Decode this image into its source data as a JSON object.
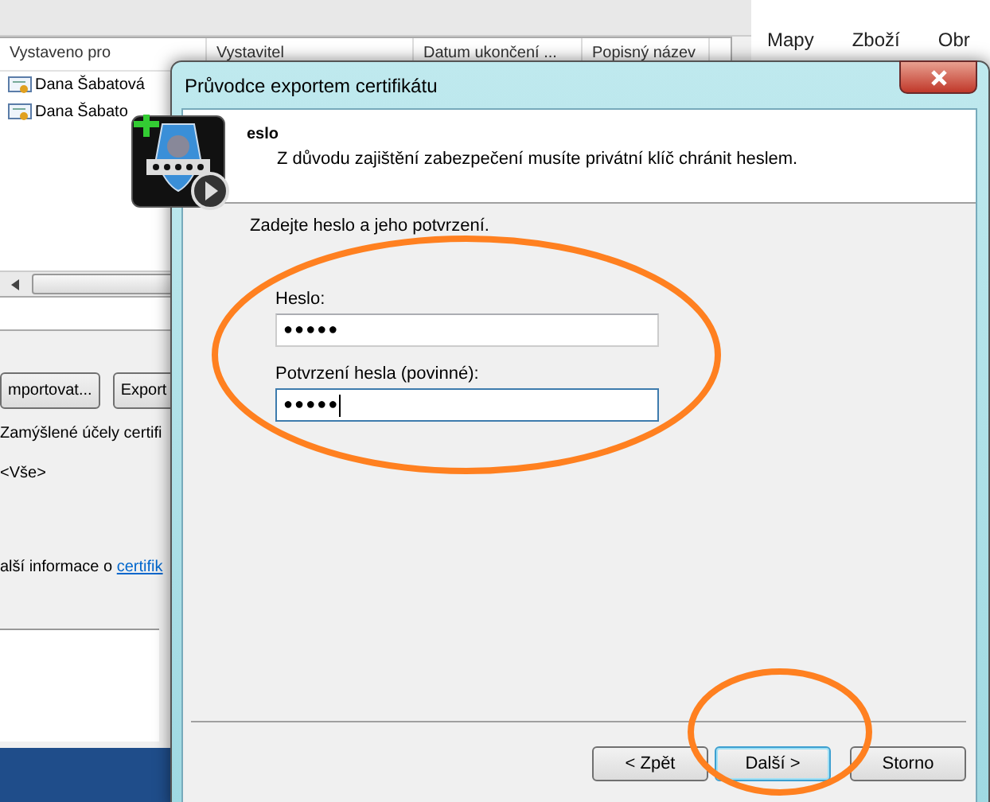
{
  "background_window": {
    "columns": [
      "Vystaveno pro",
      "Vystavitel",
      "Datum ukončení ...",
      "Popisný název"
    ],
    "rows": [
      "Dana Šabatová",
      "Dana Šabato"
    ],
    "buttons": [
      "mportovat...",
      "Export"
    ],
    "purposes_label": "Zamýšlené účely certifi",
    "purposes_value": "<Vše>",
    "info_text": "alší informace o ",
    "info_link": "certifik"
  },
  "browser": {
    "menu": [
      "Mapy",
      "Zboží",
      "Obr"
    ]
  },
  "dialog": {
    "title": "Průvodce exportem certifikátu",
    "header_title": "eslo",
    "header_subtitle": "Z důvodu zajištění zabezpečení musíte privátní klíč chránit heslem.",
    "instruction": "Zadejte heslo a jeho potvrzení.",
    "fields": [
      {
        "label": "Heslo:",
        "value": "●●●●●",
        "focused": false
      },
      {
        "label": "Potvrzení hesla (povinné):",
        "value": "●●●●●",
        "focused": true
      }
    ],
    "buttons": [
      {
        "label": "< Zpět",
        "default": false
      },
      {
        "label": "Další >",
        "default": true
      },
      {
        "label": "Storno",
        "default": false
      }
    ]
  }
}
